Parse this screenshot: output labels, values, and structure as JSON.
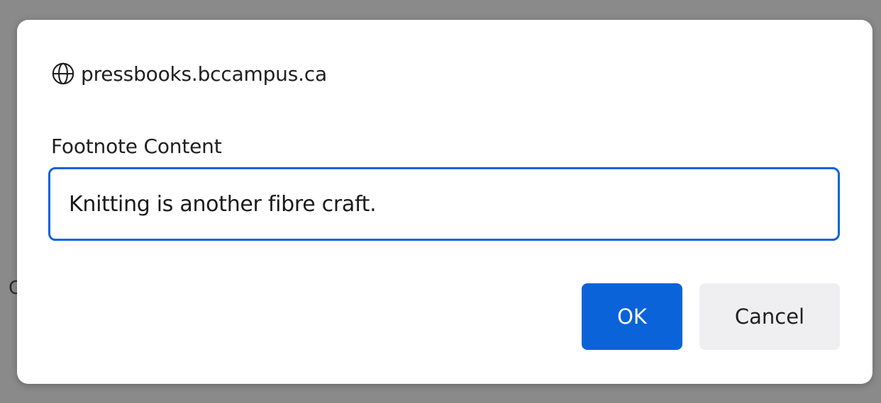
{
  "backdrop": {
    "partial_glyph": "C"
  },
  "dialog": {
    "origin": "pressbooks.bccampus.ca",
    "origin_icon": "globe-icon",
    "field_label": "Footnote Content",
    "input_value": "Knitting is another fibre craft.",
    "ok_label": "OK",
    "cancel_label": "Cancel"
  },
  "colors": {
    "accent": "#0b63d9",
    "backdrop": "#8a8a8a",
    "cancel_bg": "#efeff1"
  }
}
